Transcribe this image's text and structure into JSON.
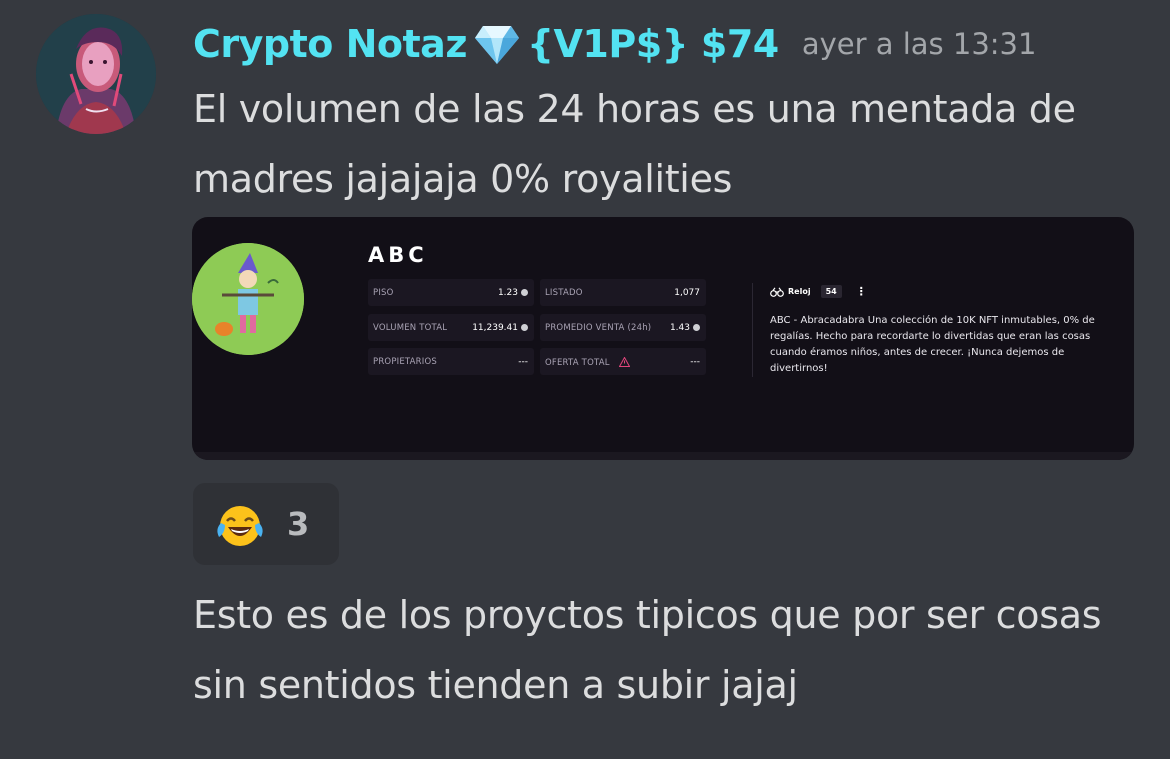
{
  "message1": {
    "author": "Crypto Notaz",
    "author_suffix": "{V1P$} $74",
    "timestamp": "ayer a las 13:31",
    "text": "El volumen de las 24 horas es una mentada de madres jajajaja 0% royalities"
  },
  "embed": {
    "collection_title": "ABC",
    "stats": [
      {
        "label": "PISO",
        "value": "1.23"
      },
      {
        "label": "LISTADO",
        "value": "1,077"
      },
      {
        "label": "VOLUMEN TOTAL",
        "value": "11,239.41"
      },
      {
        "label": "PROMEDIO VENTA (24h)",
        "value": "1.43"
      },
      {
        "label": "PROPIETARIOS",
        "value": "---"
      },
      {
        "label": "OFERTA TOTAL",
        "value": "---"
      }
    ],
    "watch_label": "Reloj",
    "watch_count": "54",
    "description": "ABC - Abracadabra Una colección de 10K NFT inmutables, 0% de regalías. Hecho para recordarte lo divertidas que eran las cosas cuando éramos niños, antes de crecer. ¡Nunca dejemos de divertirnos!"
  },
  "reaction": {
    "emoji": "joy-emoji",
    "count": "3"
  },
  "message2": {
    "text": "Esto es de los proyctos tipicos que por ser cosas sin sentidos tienden a subir jajaj"
  },
  "colors": {
    "background": "#36393f",
    "username": "#53e3f2",
    "text": "#dcddde",
    "embed_bg": "#120f17"
  }
}
